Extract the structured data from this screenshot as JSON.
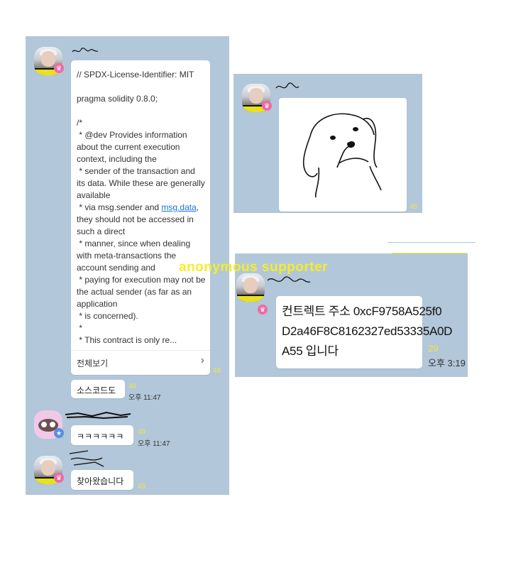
{
  "left_chat": {
    "messages": [
      {
        "code_lines": [
          "// SPDX-License-Identifier: MIT",
          "",
          "pragma solidity 0.8.0;",
          "",
          "/*",
          " * @dev Provides information about the current execution context, including the",
          " * sender of the transaction and its data. While these are generally available",
          " * via msg.sender and ",
          "msg.data",
          ", they should not be accessed in such a direct",
          " * manner, since when dealing with meta-transactions the account sending and",
          " * paying for execution may not be the actual sender (as far as an application",
          " * is concerned).",
          " *",
          " * This contract is only re..."
        ],
        "view_all_label": "전체보기",
        "view_all_chevron": "›",
        "count": "48"
      },
      {
        "text": "소스코드도",
        "count": "48",
        "time": "오후 11:47"
      },
      {
        "text": "ㅋㅋㅋㅋㅋㅋ",
        "count": "49",
        "time": "오후 11:47"
      },
      {
        "text": "찾아왔습니다",
        "count": "49"
      }
    ]
  },
  "right_top": {
    "image_count": "48"
  },
  "right_bottom": {
    "watermark": "anonymous supporter",
    "contract_message": [
      "컨트렉트 주소 0xcF9758A525f0",
      "D2a46F8C8162327ed53335A0D",
      "A55 입니다"
    ],
    "count": "29",
    "time": "오후 3:19"
  },
  "colors": {
    "chat_background": "#b2c7d9",
    "unread_count": "#f3e050",
    "watermark": "#f7ec2a",
    "link": "#1a73e8"
  },
  "icons": [
    "avatar-crown-badge",
    "avatar-star-badge",
    "dog-sketch",
    "chevron-right-icon"
  ]
}
